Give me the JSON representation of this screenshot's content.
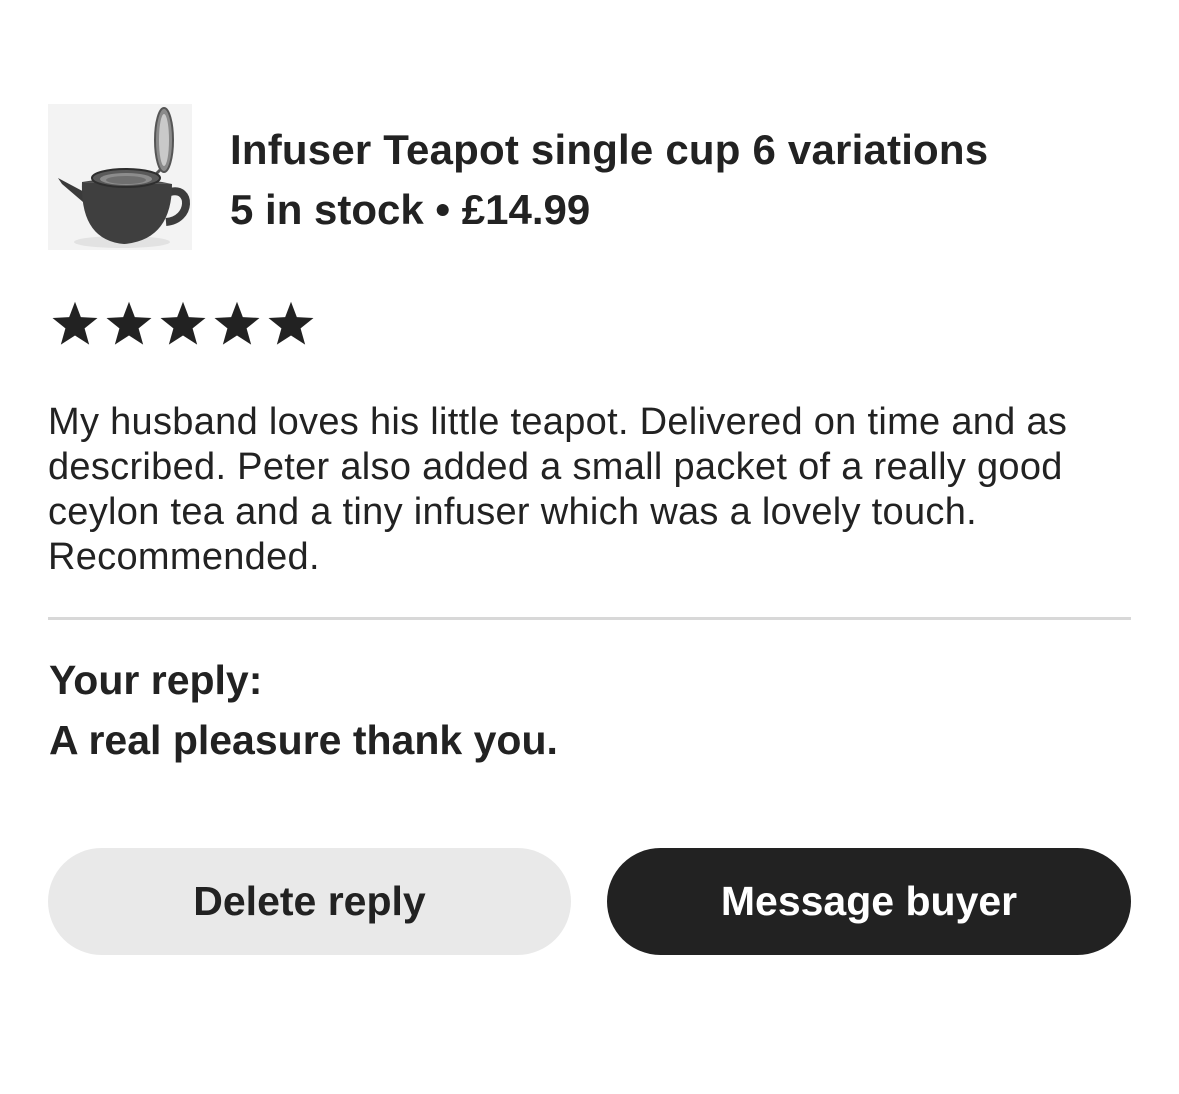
{
  "product": {
    "image_alt": "Infuser teapot",
    "title": "Infuser Teapot single cup 6 variations",
    "meta": "5 in stock • £14.99"
  },
  "review": {
    "rating": 5,
    "rating_max": 5,
    "star_color": "#222222",
    "text": "My husband loves his little teapot. Delivered on time and as described. Peter also added a small packet of a really good ceylon tea and a tiny infuser which was a lovely touch. Recommended."
  },
  "reply": {
    "label": "Your reply:",
    "text": "A real pleasure thank you."
  },
  "actions": {
    "delete_label": "Delete reply",
    "message_label": "Message buyer"
  },
  "colors": {
    "text": "#222222",
    "primary_button": "#222222",
    "secondary_button": "#e9e9e9",
    "divider": "#d8d8d8"
  }
}
